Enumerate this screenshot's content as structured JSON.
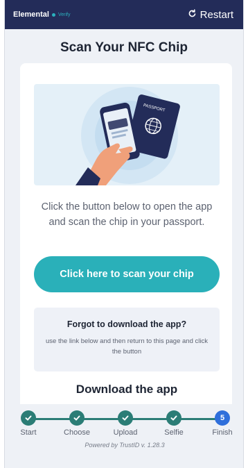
{
  "header": {
    "brand_name": "Elemental",
    "brand_sub": "Verify",
    "restart_label": "Restart",
    "background": "#232c59",
    "accent": "#2bb1bd"
  },
  "page": {
    "title": "Scan Your NFC Chip",
    "description": "Click the button below to open the app and scan the chip in your passport.",
    "scan_button_label": "Click here to scan your chip",
    "forgot": {
      "title": "Forgot to download the app?",
      "text": "use the link below and then return to this page and click the button"
    },
    "download_title": "Download the app"
  },
  "hero_image": {
    "passport_label": "PASSPORT",
    "icons": [
      "hand-holding-phone-icon",
      "passport-icon",
      "globe-icon"
    ]
  },
  "stepper": {
    "steps": [
      {
        "label": "Start",
        "state": "done"
      },
      {
        "label": "Choose",
        "state": "done"
      },
      {
        "label": "Upload",
        "state": "done"
      },
      {
        "label": "Selfie",
        "state": "done"
      },
      {
        "label": "Finish",
        "state": "current",
        "number": "5"
      }
    ],
    "done_color": "#2b7d76",
    "current_color": "#2f6fdb"
  },
  "footer": {
    "powered_by": "Powered by TrustID v. 1.28.3"
  },
  "colors": {
    "primary_button": "#2ab0b9",
    "text_dark": "#1d2433",
    "text_muted": "#5c6270"
  }
}
